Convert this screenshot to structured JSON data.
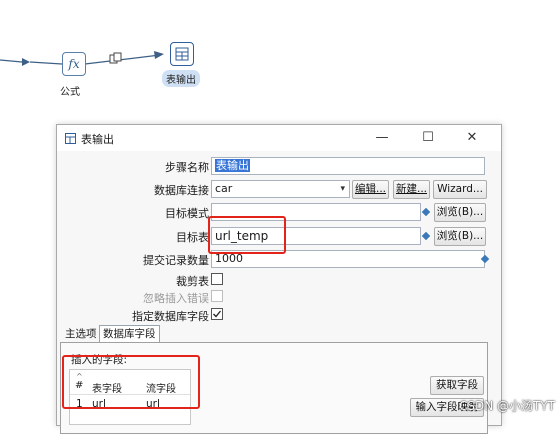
{
  "canvas": {
    "formula_step_label": "公式",
    "table_output_step_label": "表输出",
    "formula_icon_text": "fx"
  },
  "dialog": {
    "title": "表输出",
    "window_buttons": {
      "minimize": "—",
      "maximize": "☐",
      "close": "✕"
    },
    "fields": {
      "step_name_label": "步骤名称",
      "step_name_value": "表输出",
      "db_conn_label": "数据库连接",
      "db_conn_value": "car",
      "edit_button": "编辑...",
      "new_button": "新建...",
      "wizard_button": "Wizard...",
      "target_schema_label": "目标模式",
      "target_schema_value": "",
      "browse_schema_button": "浏览(B)...",
      "target_table_label": "目标表",
      "target_table_value": "url_temp",
      "browse_table_button": "浏览(B)...",
      "commit_size_label": "提交记录数量",
      "commit_size_value": "1000",
      "truncate_label": "裁剪表",
      "ignore_errors_label": "忽略插入错误",
      "specify_fields_label": "指定数据库字段"
    },
    "tabs": [
      "主选项",
      "数据库字段"
    ],
    "fields_tab": {
      "section_label": "插入的字段:",
      "columns": [
        "#",
        "表字段",
        "流字段"
      ],
      "rows": [
        {
          "num": "1",
          "table_field": "url",
          "stream_field": "url"
        }
      ],
      "get_fields_button": "获取字段",
      "input_mapping_button": "输入字段映射"
    }
  },
  "watermark": "CSDN @小汤TYT",
  "colors": {
    "highlight_red": "#e3241b",
    "selection_blue": "#3875d7",
    "hop_line": "#3d5f86"
  }
}
